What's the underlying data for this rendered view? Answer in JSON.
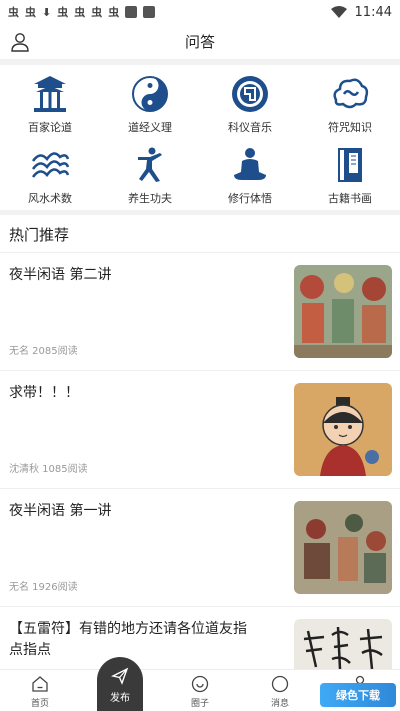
{
  "statusbar": {
    "glyphs": [
      "虫",
      "虫",
      "⬇",
      "虫",
      "虫",
      "虫",
      "虫"
    ],
    "time": "11:44"
  },
  "header": {
    "title": "问答"
  },
  "categories": [
    {
      "label": "百家论道",
      "icon": "temple-icon"
    },
    {
      "label": "道经义理",
      "icon": "yin-yang-icon"
    },
    {
      "label": "科仪音乐",
      "icon": "ritual-circle-icon"
    },
    {
      "label": "符咒知识",
      "icon": "cloud-talisman-icon"
    },
    {
      "label": "风水术数",
      "icon": "waves-icon"
    },
    {
      "label": "养生功夫",
      "icon": "martial-arts-icon"
    },
    {
      "label": "修行体悟",
      "icon": "meditation-icon"
    },
    {
      "label": "古籍书画",
      "icon": "ancient-book-icon"
    }
  ],
  "section": {
    "title": "热门推荐"
  },
  "articles": [
    {
      "title": "夜半闲语 第二讲",
      "meta": "无名 2085阅读"
    },
    {
      "title": "求带！！！",
      "meta": "沈清秋 1085阅读"
    },
    {
      "title": "夜半闲语 第一讲",
      "meta": "无名 1926阅读"
    },
    {
      "title": "【五雷符】有错的地方还请各位道友指点指点",
      "meta": ""
    }
  ],
  "nav": [
    {
      "label": "首页",
      "icon": "home-icon"
    },
    {
      "label": "发布",
      "icon": "send-icon"
    },
    {
      "label": "圈子",
      "icon": "circle-icon"
    },
    {
      "label": "消息",
      "icon": "message-icon"
    },
    {
      "label": "",
      "icon": "profile-icon"
    }
  ],
  "watermark": {
    "text": "绿色下载"
  },
  "colors": {
    "accent": "#1f4e8c",
    "publish": "#3a3a3a",
    "text": "#222222",
    "meta": "#999999"
  }
}
